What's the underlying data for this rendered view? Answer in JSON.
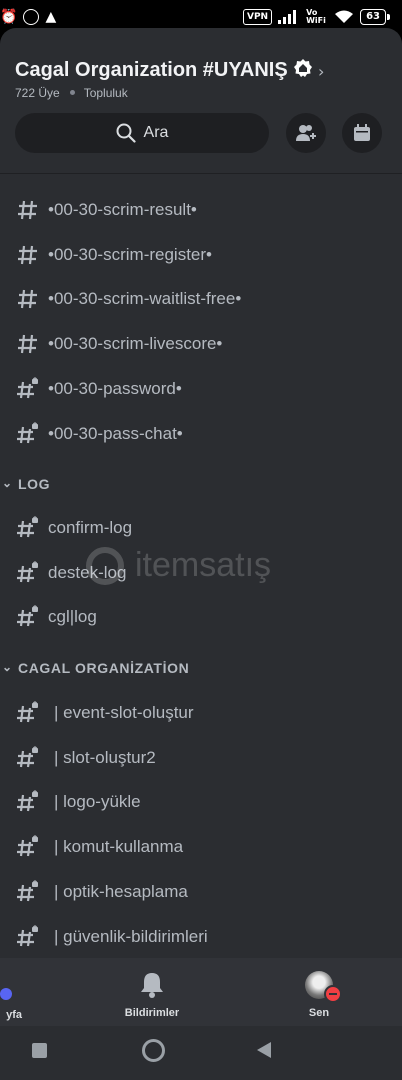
{
  "status_bar": {
    "vpn": "VPN",
    "vowifi": "Vo WiFi",
    "battery": "63"
  },
  "server": {
    "name": "Cagal Organization #UYANIŞ",
    "members": "722 Üye",
    "type": "Topluluk"
  },
  "search": {
    "label": "Ara"
  },
  "channels": [
    {
      "name": "•00-30-scrim-result•",
      "locked": false
    },
    {
      "name": "•00-30-scrim-register•",
      "locked": false
    },
    {
      "name": "•00-30-scrim-waitlist-free•",
      "locked": false
    },
    {
      "name": "•00-30-scrim-livescore•",
      "locked": false
    },
    {
      "name": "•00-30-password•",
      "locked": true
    },
    {
      "name": "•00-30-pass-chat•",
      "locked": true
    }
  ],
  "categories": [
    {
      "name": "LOG"
    },
    {
      "name": "CAGAL ORGANİZATİON"
    }
  ],
  "log_channels": [
    {
      "name": "confirm-log"
    },
    {
      "name": "destek-log"
    },
    {
      "name": "cgl|log"
    }
  ],
  "org_channels": [
    {
      "name": "| event-slot-oluştur"
    },
    {
      "name": "| slot-oluştur2"
    },
    {
      "name": "| logo-yükle"
    },
    {
      "name": "| komut-kullanma"
    },
    {
      "name": "| optik-hesaplama"
    },
    {
      "name": "| güvenlik-bildirimleri"
    }
  ],
  "watermark": {
    "text": "itemsatış"
  },
  "bottom_nav": {
    "home_label": "yfa",
    "notifications_label": "Bildirimler",
    "profile_label": "Sen"
  },
  "colors": {
    "panel": "#2b2d31",
    "channel_text": "#b5bac1",
    "status_dnd": "#f23f43",
    "unread_dot": "#5865f2"
  }
}
